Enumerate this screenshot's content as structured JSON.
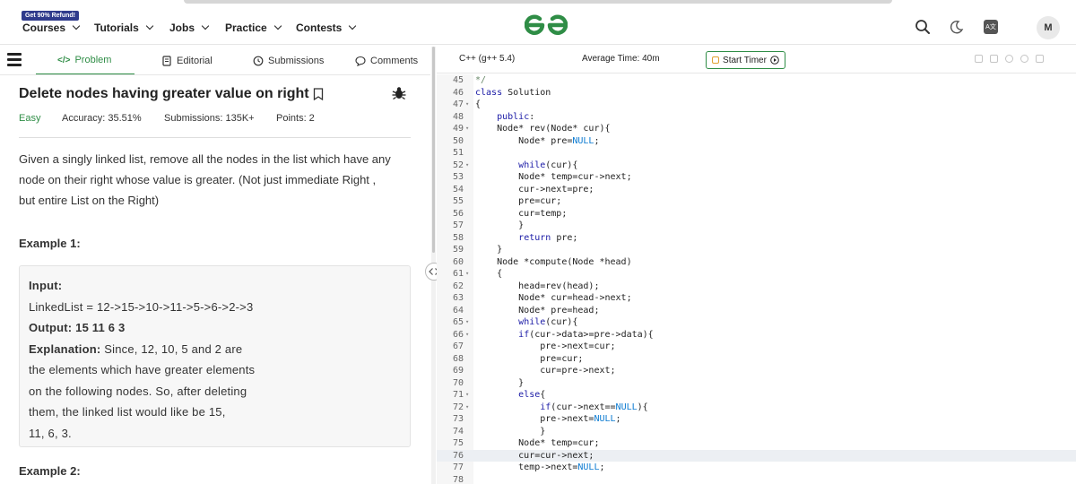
{
  "header": {
    "refund_badge": "Get 90% Refund!",
    "nav": [
      "Courses",
      "Tutorials",
      "Jobs",
      "Practice",
      "Contests"
    ],
    "avatar_letter": "M",
    "translate_label": "A文"
  },
  "problem_tabs": [
    "Problem",
    "Editorial",
    "Submissions",
    "Comments"
  ],
  "problem": {
    "title": "Delete nodes having greater value on right",
    "difficulty": "Easy",
    "accuracy": "Accuracy: 35.51%",
    "submissions": "Submissions: 135K+",
    "points": "Points: 2",
    "description": [
      "Given a singly linked list, remove all the nodes in the list which have any",
      "node on their right whose value is greater. (Not just immediate Right ,",
      "but entire List on the Right)"
    ],
    "example1_title": "Example 1:",
    "example1": {
      "input_label": "Input:",
      "input_value": "LinkedList  =  12->15->10->11->5->6->2->3",
      "output_line": "Output:  15  11  6  3",
      "explanation_label": "Explanation:",
      "explanation_lines": [
        " Since,  12,  10,  5  and  2  are",
        "the  elements  which  have  greater  elements",
        "on  the  following  nodes.  So,  after  deleting",
        "them,  the  linked  list  would  like  be  15,",
        "11,  6,  3."
      ]
    },
    "example2_title": "Example 2:"
  },
  "editor": {
    "language": "C++ (g++ 5.4)",
    "avg_time": "Average Time: 40m",
    "timer_label": "Start Timer",
    "active_line": 76,
    "lines": [
      {
        "n": "45",
        "f": "",
        "t": "*/"
      },
      {
        "n": "46",
        "f": "",
        "t": "class Solution"
      },
      {
        "n": "47",
        "f": "▾",
        "t": "{"
      },
      {
        "n": "48",
        "f": "",
        "t": "    public:"
      },
      {
        "n": "49",
        "f": "▾",
        "t": "    Node* rev(Node* cur){"
      },
      {
        "n": "50",
        "f": "",
        "t": "        Node* pre=NULL;"
      },
      {
        "n": "51",
        "f": "",
        "t": ""
      },
      {
        "n": "52",
        "f": "▾",
        "t": "        while(cur){"
      },
      {
        "n": "53",
        "f": "",
        "t": "        Node* temp=cur->next;"
      },
      {
        "n": "54",
        "f": "",
        "t": "        cur->next=pre;"
      },
      {
        "n": "55",
        "f": "",
        "t": "        pre=cur;"
      },
      {
        "n": "56",
        "f": "",
        "t": "        cur=temp;"
      },
      {
        "n": "57",
        "f": "",
        "t": "        }"
      },
      {
        "n": "58",
        "f": "",
        "t": "        return pre;"
      },
      {
        "n": "59",
        "f": "",
        "t": "    }"
      },
      {
        "n": "60",
        "f": "",
        "t": "    Node *compute(Node *head)"
      },
      {
        "n": "61",
        "f": "▾",
        "t": "    {"
      },
      {
        "n": "62",
        "f": "",
        "t": "        head=rev(head);"
      },
      {
        "n": "63",
        "f": "",
        "t": "        Node* cur=head->next;"
      },
      {
        "n": "64",
        "f": "",
        "t": "        Node* pre=head;"
      },
      {
        "n": "65",
        "f": "▾",
        "t": "        while(cur){"
      },
      {
        "n": "66",
        "f": "▾",
        "t": "        if(cur->data>=pre->data){"
      },
      {
        "n": "67",
        "f": "",
        "t": "            pre->next=cur;"
      },
      {
        "n": "68",
        "f": "",
        "t": "            pre=cur;"
      },
      {
        "n": "69",
        "f": "",
        "t": "            cur=pre->next;"
      },
      {
        "n": "70",
        "f": "",
        "t": "        }"
      },
      {
        "n": "71",
        "f": "▾",
        "t": "        else{"
      },
      {
        "n": "72",
        "f": "▾",
        "t": "            if(cur->next==NULL){"
      },
      {
        "n": "73",
        "f": "",
        "t": "            pre->next=NULL;"
      },
      {
        "n": "74",
        "f": "",
        "t": "            }"
      },
      {
        "n": "75",
        "f": "",
        "t": "        Node* temp=cur;"
      },
      {
        "n": "76",
        "f": "",
        "t": "        cur=cur->next;"
      },
      {
        "n": "77",
        "f": "",
        "t": "        temp->next=NULL;"
      },
      {
        "n": "78",
        "f": "",
        "t": ""
      }
    ]
  },
  "colors": {
    "brand_green": "#2f8d46",
    "refund_bg": "#2f3b8c",
    "keyword_blue": "#1a1aa6",
    "null_blue": "#0b7ad1"
  }
}
